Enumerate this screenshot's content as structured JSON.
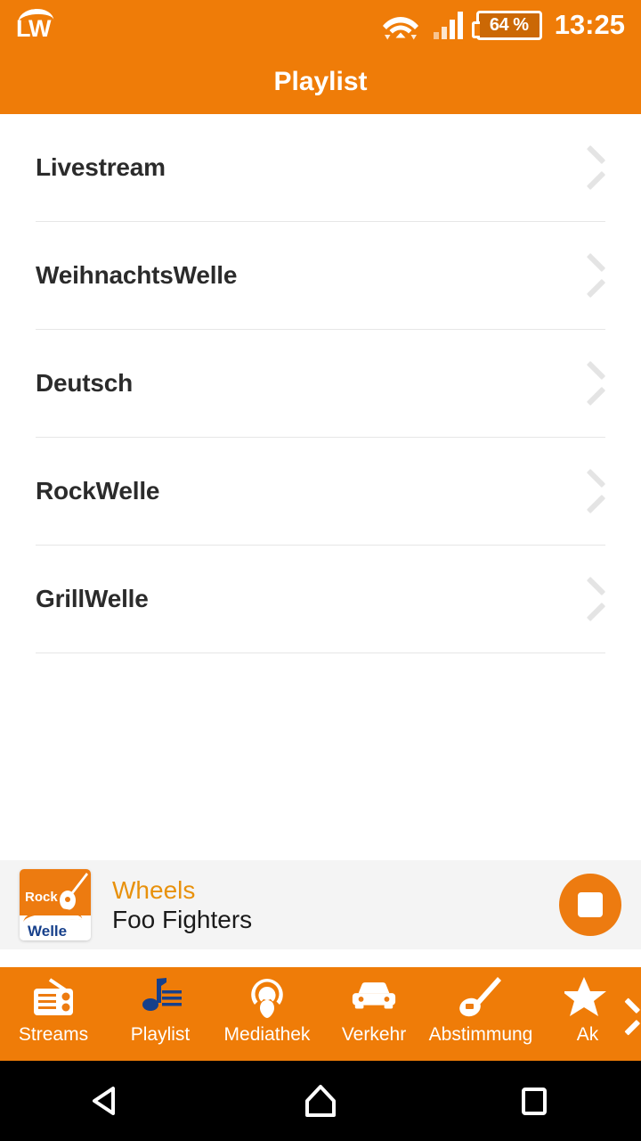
{
  "colors": {
    "brand_orange": "#EF7C08",
    "accent_orange": "#ED7B10",
    "title_orange": "#E8910C",
    "nav_selected_blue": "#17408B",
    "nowplaying_bg": "#F4F4F4",
    "divider": "#e6e6e6",
    "chevron_gray": "#e4e4e4"
  },
  "statusbar": {
    "logo_text": "LW",
    "logo_icon": "lw-wave-logo",
    "wifi_icon": "wifi-icon",
    "signal_icon": "cellular-signal-icon",
    "battery_icon": "battery-icon",
    "battery_text": "64 %",
    "clock": "13:25"
  },
  "header": {
    "title": "Playlist"
  },
  "list": {
    "items": [
      {
        "label": "Livestream",
        "chevron_icon": "chevron-right-icon"
      },
      {
        "label": "WeihnachtsWelle",
        "chevron_icon": "chevron-right-icon"
      },
      {
        "label": "Deutsch",
        "chevron_icon": "chevron-right-icon"
      },
      {
        "label": "RockWelle",
        "chevron_icon": "chevron-right-icon"
      },
      {
        "label": "GrillWelle",
        "chevron_icon": "chevron-right-icon"
      }
    ]
  },
  "nowplaying": {
    "artwork_icon": "rockwelle-album-art",
    "artwork_top_text": "Rock",
    "artwork_bottom_text": "Welle",
    "track_title": "Wheels",
    "track_artist": "Foo Fighters",
    "stop_button_icon": "stop-icon"
  },
  "bottomnav": {
    "selected": "Playlist",
    "scroll_indicator_icon": "chevron-right-icon",
    "items": [
      {
        "label": "Streams",
        "icon": "radio-icon",
        "selected": false
      },
      {
        "label": "Playlist",
        "icon": "music-note-icon",
        "selected": true
      },
      {
        "label": "Mediathek",
        "icon": "podcast-icon",
        "selected": false
      },
      {
        "label": "Verkehr",
        "icon": "car-icon",
        "selected": false
      },
      {
        "label": "Abstimmung",
        "icon": "guitar-icon",
        "selected": false
      },
      {
        "label": "Ak",
        "icon": "star-icon",
        "selected": false
      }
    ]
  },
  "androidnav": {
    "back_icon": "back-triangle-icon",
    "home_icon": "home-icon",
    "recents_icon": "recents-square-icon"
  }
}
